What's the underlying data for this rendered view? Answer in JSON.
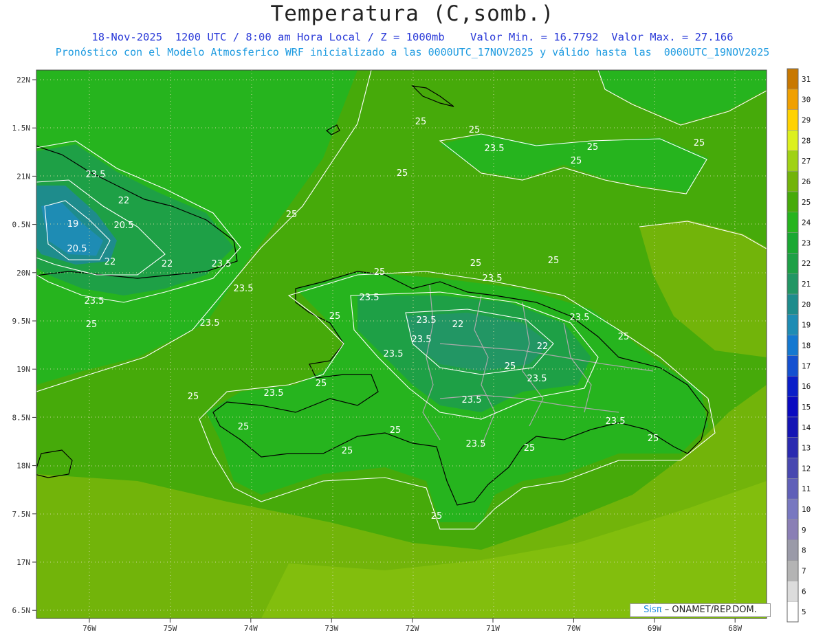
{
  "header": {
    "title": "Temperatura (C,somb.)",
    "subtitle": "18-Nov-2025  1200 UTC / 8:00 am Hora Local / Z = 1000mb    Valor Min. = 16.7792  Valor Max. = 27.166",
    "subtitle2": "Pronóstico con el Modelo Atmosferico WRF inicializado a las 0000UTC_17NOV2025 y válido hasta las  0000UTC_19NOV2025"
  },
  "axes": {
    "lat_labels": [
      "22N",
      "1.5N",
      "21N",
      "0.5N",
      "20N",
      "9.5N",
      "19N",
      "8.5N",
      "18N",
      "7.5N",
      "17N",
      "6.5N"
    ],
    "lon_labels": [
      "76W",
      "75W",
      "74W",
      "73W",
      "72W",
      "71W",
      "70W",
      "69W",
      "68W"
    ]
  },
  "colorbar": {
    "labels": [
      "5",
      "6",
      "7",
      "8",
      "9",
      "10",
      "11",
      "12",
      "13",
      "14",
      "15",
      "16",
      "17",
      "18",
      "19",
      "20",
      "21",
      "22",
      "23",
      "24",
      "25",
      "26",
      "27",
      "28",
      "29",
      "30",
      "31"
    ],
    "colors": [
      "#ffffff",
      "#dcdcdc",
      "#b4b4b4",
      "#9a9aa8",
      "#8a7fb5",
      "#7878c0",
      "#6060b8",
      "#4848b0",
      "#2a2ab0",
      "#1414b4",
      "#0a0ac0",
      "#0a1ec8",
      "#1450d0",
      "#1478d0",
      "#1e8cb4",
      "#1e8c8c",
      "#229664",
      "#1ea046",
      "#1aa832",
      "#26b41e",
      "#46aa0a",
      "#72b40a",
      "#a0d214",
      "#dcf01e",
      "#ffd200",
      "#f0a000",
      "#c87800"
    ]
  },
  "contour_labels": [
    "25",
    "25",
    "23.5",
    "25",
    "25",
    "25",
    "23.5",
    "23.5",
    "22",
    "19",
    "20.5",
    "20.5",
    "22",
    "22",
    "23.5",
    "23.5",
    "25",
    "25",
    "23.5",
    "25",
    "25",
    "23.5",
    "25",
    "23.5",
    "23.5",
    "22",
    "23.5",
    "23.5",
    "23.5",
    "25",
    "23.5",
    "25",
    "22",
    "25",
    "23.5",
    "25",
    "23.5",
    "23.5",
    "25",
    "25",
    "25",
    "25",
    "25",
    "23.5",
    "25",
    "25",
    "25"
  ],
  "credit": {
    "brand": "Sisπ",
    "text": "– ONAMET/REP.DOM."
  },
  "colors": {
    "background_field": "#46aa0a",
    "land_dark": "#26b41e",
    "sea_warm": "#72b40a",
    "coast": "#000000",
    "contour": "#ffffff",
    "borders": "#aaaaaa"
  }
}
